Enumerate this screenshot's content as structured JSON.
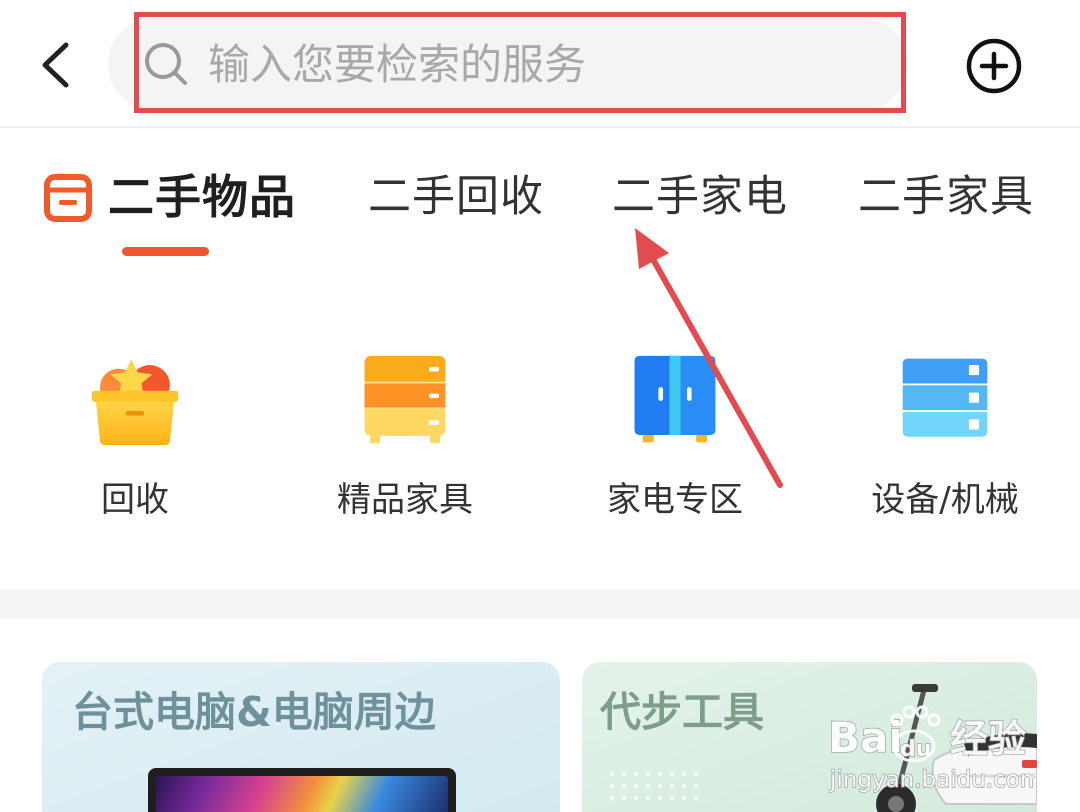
{
  "colors": {
    "accent": "#f0562e",
    "annotation": "#e24b50",
    "text": "#333333",
    "placeholder": "#a8a8a8"
  },
  "top_bar": {
    "back_icon": "chevron-left-icon",
    "search": {
      "icon": "search-icon",
      "placeholder": "输入您要检索的服务",
      "value": ""
    },
    "add_icon": "plus-circle-icon"
  },
  "tabs": {
    "logo_icon": "box-icon",
    "items": [
      {
        "label": "二手物品",
        "active": true
      },
      {
        "label": "二手回收",
        "active": false
      },
      {
        "label": "二手家电",
        "active": false
      },
      {
        "label": "二手家具",
        "active": false
      }
    ]
  },
  "categories": [
    {
      "label": "回收",
      "icon": "recycle-box-icon"
    },
    {
      "label": "精品家具",
      "icon": "cabinet-icon"
    },
    {
      "label": "家电专区",
      "icon": "refrigerator-icon"
    },
    {
      "label": "设备/机械",
      "icon": "machine-icon"
    }
  ],
  "cards": [
    {
      "title": "台式电脑&电脑周边",
      "image": "desktop-monitor-image"
    },
    {
      "title": "代步工具",
      "image": "electric-scooter-image"
    }
  ],
  "watermark": {
    "brand_left": "Bai",
    "brand_right": "du",
    "brand_cn": "经验",
    "url": "jingyan.baidu.com"
  }
}
